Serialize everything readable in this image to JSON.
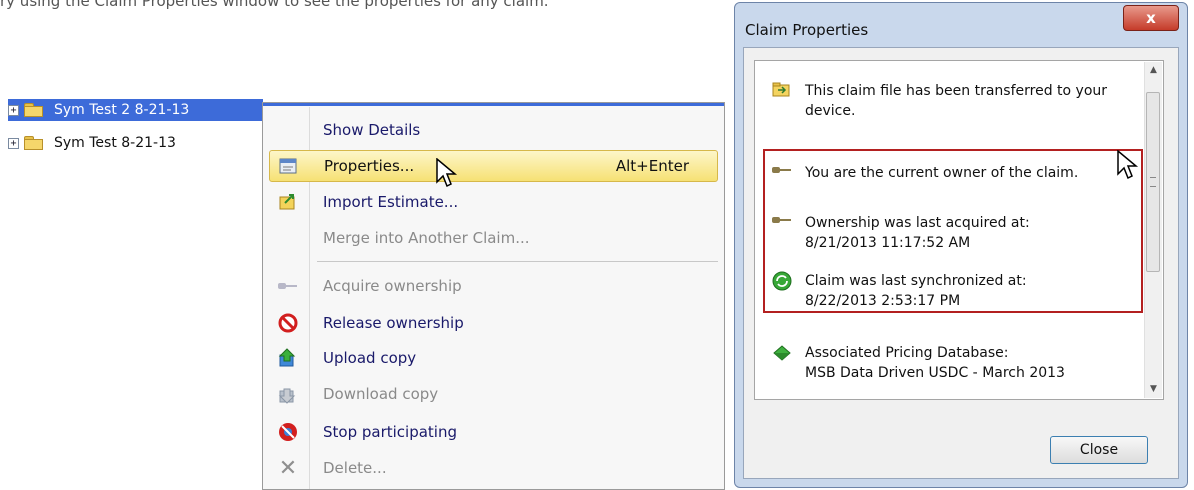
{
  "caption": "ry using the Claim Properties window to see the properties for any claim.",
  "tree": {
    "items": [
      {
        "label": "Sym Test 2 8-21-13",
        "selected": true
      },
      {
        "label": "Sym Test 8-21-13",
        "selected": false
      }
    ]
  },
  "context_menu": {
    "items": [
      {
        "label": "Show Details",
        "enabled": true,
        "icon": "none"
      },
      {
        "label": "Properties...",
        "accelerator": "Alt+Enter",
        "enabled": true,
        "hovered": true,
        "icon": "properties-icon"
      },
      {
        "label": "Import Estimate...",
        "enabled": true,
        "icon": "import-icon"
      },
      {
        "label": "Merge into Another Claim...",
        "enabled": false,
        "icon": "none"
      },
      {
        "label": "Acquire ownership",
        "enabled": false,
        "icon": "key-icon"
      },
      {
        "label": "Release ownership",
        "enabled": true,
        "icon": "no-entry-icon"
      },
      {
        "label": "Upload copy",
        "enabled": true,
        "icon": "upload-icon"
      },
      {
        "label": "Download copy",
        "enabled": false,
        "icon": "download-icon"
      },
      {
        "label": "Stop participating",
        "enabled": true,
        "icon": "stop-icon"
      },
      {
        "label": "Delete...",
        "enabled": false,
        "icon": "delete-x-icon"
      }
    ]
  },
  "dialog": {
    "title": "Claim Properties",
    "close_glyph": "x",
    "entries": [
      {
        "icon": "transfer-icon",
        "line1": "This claim file has been transferred to your",
        "line2": "device."
      },
      {
        "icon": "key-icon",
        "line1": "You are the current owner of the claim.",
        "line2": ""
      },
      {
        "icon": "key-icon",
        "line1": "Ownership was last acquired at:",
        "line2": "8/21/2013 11:17:52 AM"
      },
      {
        "icon": "sync-icon",
        "line1": "Claim was last synchronized at:",
        "line2": "8/22/2013 2:53:17 PM"
      },
      {
        "icon": "database-icon",
        "line1": "Associated Pricing Database:",
        "line2": "MSB Data Driven USDC - March 2013"
      }
    ],
    "close_button": "Close"
  },
  "colors": {
    "selection": "#3d6bd9",
    "hover_gradient_top": "#fdf6c9",
    "hover_gradient_bottom": "#f6e174",
    "highlight_box": "#b32020",
    "enabled_text": "#1a1a6a",
    "disabled_text": "#8a8a8a"
  }
}
